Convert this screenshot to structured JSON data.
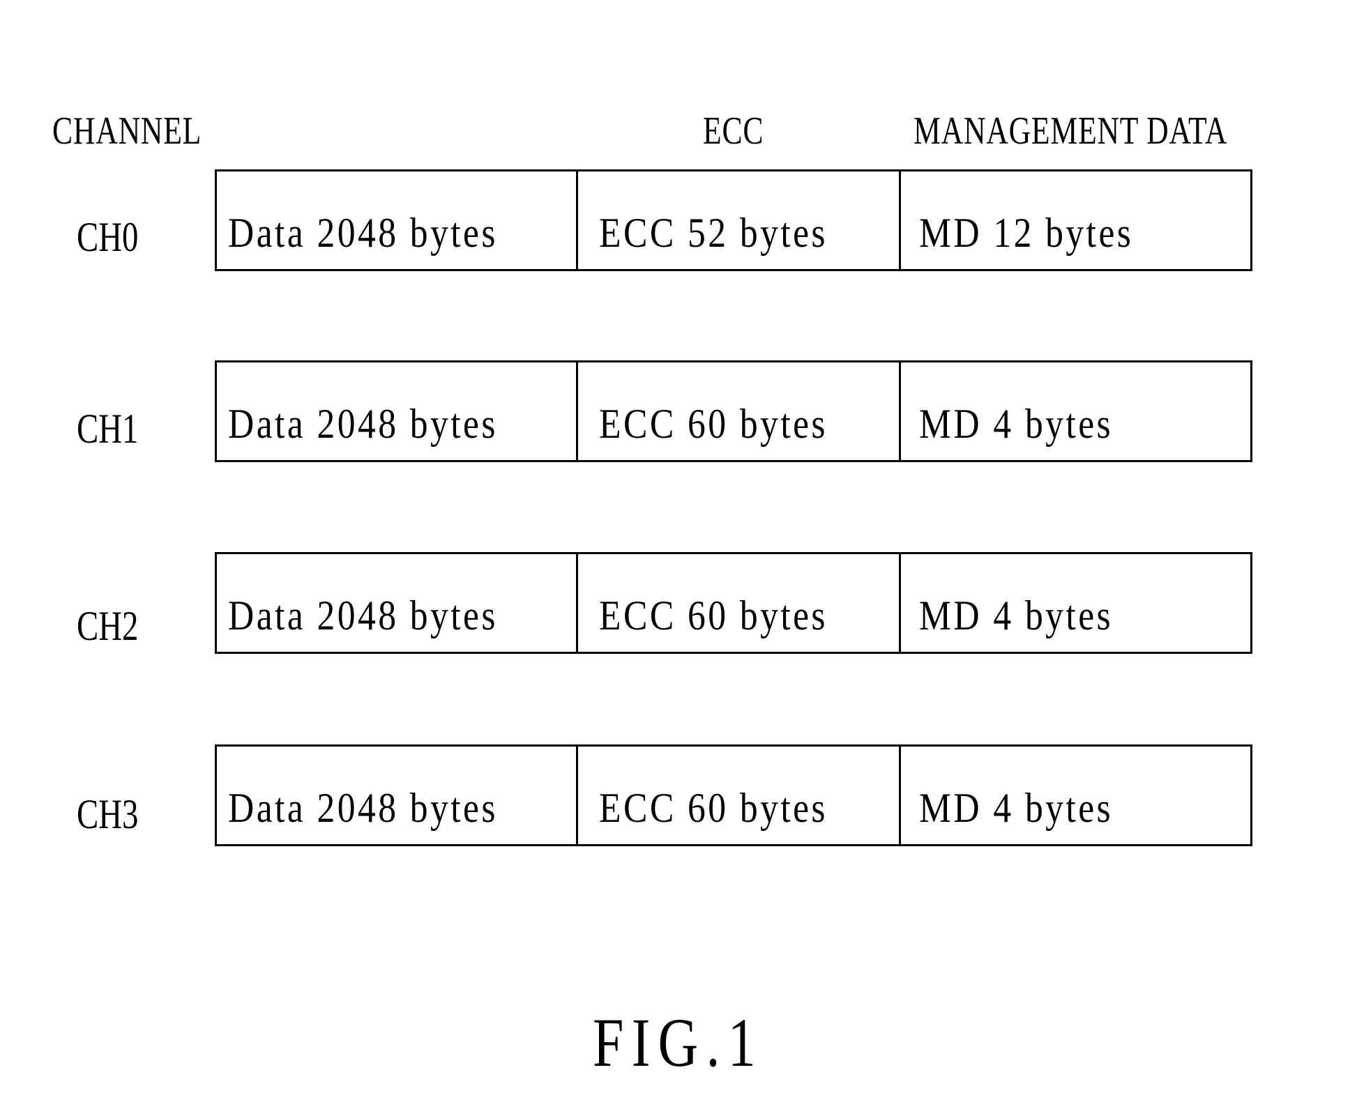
{
  "headers": {
    "channel": "CHANNEL",
    "ecc": "ECC",
    "management_data": "MANAGEMENT DATA"
  },
  "rows": [
    {
      "channel": "CH0",
      "data": "Data 2048 bytes",
      "ecc": "ECC 52 bytes",
      "md": "MD 12 bytes"
    },
    {
      "channel": "CH1",
      "data": "Data 2048 bytes",
      "ecc": "ECC 60 bytes",
      "md": "MD 4 bytes"
    },
    {
      "channel": "CH2",
      "data": "Data 2048 bytes",
      "ecc": "ECC 60 bytes",
      "md": "MD 4 bytes"
    },
    {
      "channel": "CH3",
      "data": "Data 2048 bytes",
      "ecc": "ECC 60 bytes",
      "md": "MD 4 bytes"
    }
  ],
  "figure_label": "FIG.1"
}
